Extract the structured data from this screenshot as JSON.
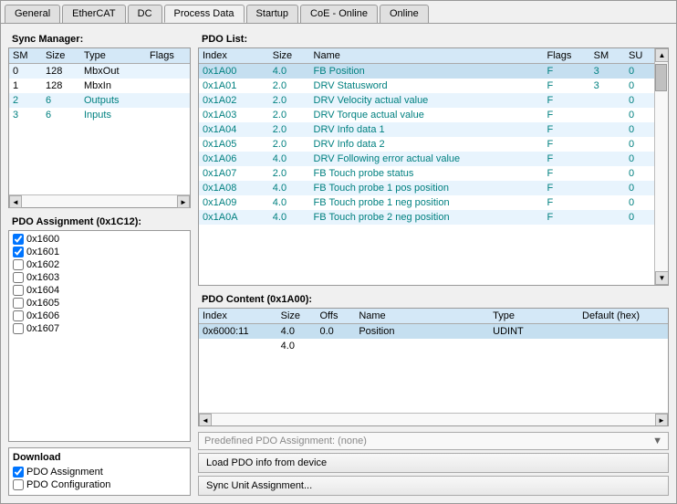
{
  "tabs": [
    {
      "label": "General",
      "active": false
    },
    {
      "label": "EtherCAT",
      "active": false
    },
    {
      "label": "DC",
      "active": false
    },
    {
      "label": "Process Data",
      "active": true
    },
    {
      "label": "Startup",
      "active": false
    },
    {
      "label": "CoE - Online",
      "active": false
    },
    {
      "label": "Online",
      "active": false
    }
  ],
  "sync_manager": {
    "title": "Sync Manager:",
    "columns": [
      "SM",
      "Size",
      "Type",
      "Flags"
    ],
    "rows": [
      {
        "sm": "0",
        "size": "128",
        "type": "MbxOut",
        "flags": "",
        "even": true
      },
      {
        "sm": "1",
        "size": "128",
        "type": "MbxIn",
        "flags": "",
        "even": false
      },
      {
        "sm": "2",
        "size": "6",
        "type": "Outputs",
        "flags": "",
        "even": true,
        "teal": true
      },
      {
        "sm": "3",
        "size": "6",
        "type": "Inputs",
        "flags": "",
        "even": false,
        "teal": true
      }
    ]
  },
  "pdo_list": {
    "title": "PDO List:",
    "columns": [
      "Index",
      "Size",
      "Name",
      "Flags",
      "SM",
      "SU"
    ],
    "rows": [
      {
        "index": "0x1A00",
        "size": "4.0",
        "name": "FB Position",
        "flags": "F",
        "sm": "3",
        "su": "0",
        "selected": true
      },
      {
        "index": "0x1A01",
        "size": "2.0",
        "name": "DRV Statusword",
        "flags": "F",
        "sm": "3",
        "su": "0",
        "selected": false
      },
      {
        "index": "0x1A02",
        "size": "2.0",
        "name": "DRV Velocity actual value",
        "flags": "F",
        "sm": "",
        "su": "0",
        "selected": false
      },
      {
        "index": "0x1A03",
        "size": "2.0",
        "name": "DRV Torque actual value",
        "flags": "F",
        "sm": "",
        "su": "0",
        "selected": false
      },
      {
        "index": "0x1A04",
        "size": "2.0",
        "name": "DRV Info data 1",
        "flags": "F",
        "sm": "",
        "su": "0",
        "selected": false
      },
      {
        "index": "0x1A05",
        "size": "2.0",
        "name": "DRV Info data 2",
        "flags": "F",
        "sm": "",
        "su": "0",
        "selected": false
      },
      {
        "index": "0x1A06",
        "size": "4.0",
        "name": "DRV Following error actual value",
        "flags": "F",
        "sm": "",
        "su": "0",
        "selected": false
      },
      {
        "index": "0x1A07",
        "size": "2.0",
        "name": "FB Touch probe status",
        "flags": "F",
        "sm": "",
        "su": "0",
        "selected": false
      },
      {
        "index": "0x1A08",
        "size": "4.0",
        "name": "FB Touch probe 1 pos position",
        "flags": "F",
        "sm": "",
        "su": "0",
        "selected": false
      },
      {
        "index": "0x1A09",
        "size": "4.0",
        "name": "FB Touch probe 1 neg position",
        "flags": "F",
        "sm": "",
        "su": "0",
        "selected": false
      },
      {
        "index": "0x1A0A",
        "size": "4.0",
        "name": "FB Touch probe 2 neg position",
        "flags": "F",
        "sm": "",
        "su": "0",
        "selected": false
      }
    ]
  },
  "pdo_assignment": {
    "title": "PDO Assignment (0x1C12):",
    "items": [
      {
        "label": "0x1600",
        "checked": true
      },
      {
        "label": "0x1601",
        "checked": true
      },
      {
        "label": "0x1602",
        "checked": false
      },
      {
        "label": "0x1603",
        "checked": false
      },
      {
        "label": "0x1604",
        "checked": false
      },
      {
        "label": "0x1605",
        "checked": false
      },
      {
        "label": "0x1606",
        "checked": false
      },
      {
        "label": "0x1607",
        "checked": false
      }
    ]
  },
  "pdo_content": {
    "title": "PDO Content (0x1A00):",
    "columns": [
      "Index",
      "Size",
      "Offs",
      "Name",
      "Type",
      "Default (hex)"
    ],
    "rows": [
      {
        "index": "0x6000:11",
        "size": "4.0",
        "offs": "0.0",
        "name": "Position",
        "type": "UDINT",
        "default": ""
      },
      {
        "index": "",
        "size": "4.0",
        "offs": "",
        "name": "",
        "type": "",
        "default": ""
      }
    ]
  },
  "download": {
    "title": "Download",
    "items": [
      {
        "label": "PDO Assignment",
        "checked": true
      },
      {
        "label": "PDO Configuration",
        "checked": false
      }
    ]
  },
  "bottom_controls": {
    "predefined_label": "Predefined PDO Assignment: (none)",
    "load_button": "Load PDO info from device",
    "sync_button": "Sync Unit Assignment..."
  }
}
